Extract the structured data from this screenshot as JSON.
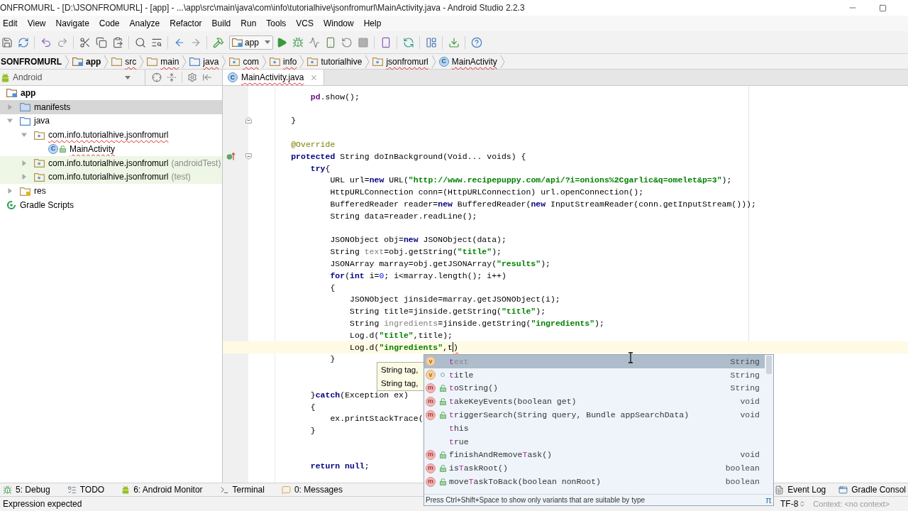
{
  "window": {
    "title": "ONFROMURL - [D:\\JSONFROMURL] - [app] - ...\\app\\src\\main\\java\\com\\info\\tutorialhive\\jsonfromurl\\MainActivity.java - Android Studio 2.2.3"
  },
  "menu": [
    "Edit",
    "View",
    "Navigate",
    "Code",
    "Analyze",
    "Refactor",
    "Build",
    "Run",
    "Tools",
    "VCS",
    "Window",
    "Help"
  ],
  "toolbar": {
    "run_config": "app"
  },
  "breadcrumbs": [
    {
      "label": "SONFROMURL",
      "kind": "project",
      "misspelled": false
    },
    {
      "label": "app",
      "kind": "module",
      "misspelled": false
    },
    {
      "label": "src",
      "kind": "folder",
      "misspelled": true
    },
    {
      "label": "main",
      "kind": "folder",
      "misspelled": true
    },
    {
      "label": "java",
      "kind": "source-folder",
      "misspelled": true
    },
    {
      "label": "com",
      "kind": "package",
      "misspelled": true
    },
    {
      "label": "info",
      "kind": "package",
      "misspelled": true
    },
    {
      "label": "tutorialhive",
      "kind": "package",
      "misspelled": false
    },
    {
      "label": "jsonfromurl",
      "kind": "package",
      "misspelled": true
    },
    {
      "label": "MainActivity",
      "kind": "class",
      "icon_letter": "C",
      "misspelled": true
    }
  ],
  "project_pane": {
    "view": "Android",
    "tree": [
      {
        "label": "app",
        "kind": "module",
        "selected": false,
        "test": false,
        "misspelled": false,
        "children": [
          {
            "label": "manifests",
            "kind": "manifest-folder",
            "expanded": false,
            "selected": true,
            "test": false,
            "misspelled": false
          },
          {
            "label": "java",
            "kind": "source-folder",
            "expanded": true,
            "selected": false,
            "test": false,
            "misspelled": false,
            "children": [
              {
                "label": "com.info.tutorialhive.jsonfromurl",
                "kind": "package",
                "expanded": true,
                "selected": false,
                "test": false,
                "misspelled": true,
                "children": [
                  {
                    "label": "MainActivity",
                    "kind": "class",
                    "icon_letter": "C",
                    "selected": false,
                    "test": false,
                    "misspelled": true
                  }
                ]
              },
              {
                "label": "com.info.tutorialhive.jsonfromurl",
                "suffix": "(androidTest)",
                "kind": "package",
                "expanded": false,
                "selected": false,
                "test": true,
                "misspelled": false
              },
              {
                "label": "com.info.tutorialhive.jsonfromurl",
                "suffix": "(test)",
                "kind": "package",
                "expanded": false,
                "selected": false,
                "test": true,
                "misspelled": false
              }
            ]
          },
          {
            "label": "res",
            "kind": "res-folder",
            "expanded": false,
            "selected": false,
            "test": false,
            "misspelled": false
          }
        ]
      },
      {
        "label": "Gradle Scripts",
        "kind": "gradle",
        "selected": false,
        "test": false,
        "misspelled": false
      }
    ]
  },
  "editor": {
    "tabs": [
      {
        "label": "MainActivity.java",
        "kind": "class",
        "icon_letter": "C",
        "selected": true,
        "misspelled": true
      }
    ],
    "lines": [
      {
        "children": [
          {
            "tokens": [
              {
                "text": "pd",
                "kind": "field"
              },
              {
                "text": ".show();",
                "kind": "plain"
              }
            ],
            "current": false
          }
        ]
      },
      {
        "current": false
      },
      {
        "gutter": [
          {
            "kind": "fold-end"
          }
        ],
        "tokens": [
          {
            "text": "}",
            "kind": "plain"
          }
        ],
        "current": false
      },
      {
        "current": false
      },
      {
        "tokens": [
          {
            "text": "@Override",
            "kind": "annotation"
          }
        ],
        "current": false
      },
      {
        "gutter": [
          {
            "kind": "override"
          },
          {
            "kind": "fold-start"
          }
        ],
        "tokens": [
          {
            "text": "protected",
            "kind": "kw"
          },
          {
            "text": " String doInBackground(Void... voids) {",
            "kind": "plain"
          }
        ],
        "current": false,
        "children": [
          {
            "tokens": [
              {
                "text": "try",
                "kind": "kw"
              },
              {
                "text": "{",
                "kind": "plain"
              }
            ],
            "current": false,
            "children": [
              {
                "tokens": [
                  {
                    "text": "URL url=",
                    "kind": "plain"
                  },
                  {
                    "text": "new",
                    "kind": "kw"
                  },
                  {
                    "text": " URL(",
                    "kind": "plain"
                  },
                  {
                    "text": "\"http://www.recipepuppy.com/api/?i=onions%2Cgarlic&q=omelet&p=3\"",
                    "kind": "str"
                  },
                  {
                    "text": ");",
                    "kind": "plain"
                  }
                ],
                "current": false
              },
              {
                "tokens": [
                  {
                    "text": "HttpURLConnection conn=(HttpURLConnection) url.openConnection();",
                    "kind": "plain"
                  }
                ],
                "current": false
              },
              {
                "tokens": [
                  {
                    "text": "BufferedReader reader=",
                    "kind": "plain"
                  },
                  {
                    "text": "new",
                    "kind": "kw"
                  },
                  {
                    "text": " BufferedReader(",
                    "kind": "plain"
                  },
                  {
                    "text": "new",
                    "kind": "kw"
                  },
                  {
                    "text": " InputStreamReader(conn.getInputStream()));",
                    "kind": "plain"
                  }
                ],
                "current": false
              },
              {
                "tokens": [
                  {
                    "text": "String data=reader.readLine();",
                    "kind": "plain"
                  }
                ],
                "current": false
              },
              {
                "current": false
              },
              {
                "tokens": [
                  {
                    "text": "JSONObject obj=",
                    "kind": "plain"
                  },
                  {
                    "text": "new",
                    "kind": "kw"
                  },
                  {
                    "text": " JSONObject(data);",
                    "kind": "plain"
                  }
                ],
                "current": false
              },
              {
                "tokens": [
                  {
                    "text": "String ",
                    "kind": "plain"
                  },
                  {
                    "text": "text",
                    "kind": "unused"
                  },
                  {
                    "text": "=obj.getString(",
                    "kind": "plain"
                  },
                  {
                    "text": "\"title\"",
                    "kind": "str"
                  },
                  {
                    "text": ");",
                    "kind": "plain"
                  }
                ],
                "current": false
              },
              {
                "tokens": [
                  {
                    "text": "JSONArray marray=obj.getJSONArray(",
                    "kind": "plain"
                  },
                  {
                    "text": "\"results\"",
                    "kind": "str"
                  },
                  {
                    "text": ");",
                    "kind": "plain"
                  }
                ],
                "current": false
              },
              {
                "tokens": [
                  {
                    "text": "for",
                    "kind": "kw"
                  },
                  {
                    "text": "(",
                    "kind": "plain"
                  },
                  {
                    "text": "int",
                    "kind": "kw"
                  },
                  {
                    "text": " i=",
                    "kind": "plain"
                  },
                  {
                    "text": "0",
                    "kind": "num"
                  },
                  {
                    "text": "; i<marray.length(); i++)",
                    "kind": "plain"
                  }
                ],
                "current": false
              },
              {
                "tokens": [
                  {
                    "text": "{",
                    "kind": "plain"
                  }
                ],
                "current": false,
                "children": [
                  {
                    "tokens": [
                      {
                        "text": "JSONObject jinside=marray.getJSONObject(i);",
                        "kind": "plain"
                      }
                    ],
                    "current": false
                  },
                  {
                    "tokens": [
                      {
                        "text": "String title=jinside.getString(",
                        "kind": "plain"
                      },
                      {
                        "text": "\"title\"",
                        "kind": "str"
                      },
                      {
                        "text": ");",
                        "kind": "plain"
                      }
                    ],
                    "current": false
                  },
                  {
                    "tokens": [
                      {
                        "text": "String ",
                        "kind": "plain"
                      },
                      {
                        "text": "ingredients",
                        "kind": "unused"
                      },
                      {
                        "text": "=jinside.getString(",
                        "kind": "plain"
                      },
                      {
                        "text": "\"ingredients\"",
                        "kind": "str"
                      },
                      {
                        "text": ");",
                        "kind": "plain"
                      }
                    ],
                    "current": false
                  },
                  {
                    "tokens": [
                      {
                        "text": "Log.d(",
                        "kind": "plain"
                      },
                      {
                        "text": "\"title\"",
                        "kind": "str"
                      },
                      {
                        "text": ",title);",
                        "kind": "plain"
                      }
                    ],
                    "current": false
                  },
                  {
                    "tokens": [
                      {
                        "text": "Log.d(",
                        "kind": "plain"
                      },
                      {
                        "text": "\"ingredients\"",
                        "kind": "str"
                      },
                      {
                        "text": ",t",
                        "kind": "plain"
                      },
                      {
                        "kind": "caret"
                      },
                      {
                        "text": ")",
                        "kind": "error"
                      }
                    ],
                    "current": true
                  }
                ]
              },
              {
                "tokens": [
                  {
                    "text": "}",
                    "kind": "plain"
                  }
                ],
                "current": false
              },
              {
                "current": false
              },
              {
                "current": false
              }
            ]
          },
          {
            "tokens": [
              {
                "text": "}",
                "kind": "plain"
              },
              {
                "text": "catch",
                "kind": "kw"
              },
              {
                "text": "(Exception ex)",
                "kind": "plain"
              }
            ],
            "current": false
          },
          {
            "tokens": [
              {
                "text": "{",
                "kind": "plain"
              }
            ],
            "current": false,
            "children": [
              {
                "tokens": [
                  {
                    "text": "ex.printStackTrace(",
                    "kind": "plain"
                  }
                ],
                "current": false
              }
            ]
          },
          {
            "tokens": [
              {
                "text": "}",
                "kind": "plain"
              }
            ],
            "current": false
          },
          {
            "current": false
          },
          {
            "current": false
          },
          {
            "tokens": [
              {
                "text": "return null",
                "kind": "kw"
              },
              {
                "text": ";",
                "kind": "plain"
              }
            ],
            "current": false
          }
        ]
      }
    ],
    "param_hints": [
      "String tag,",
      "String tag,"
    ],
    "completion": {
      "items": [
        {
          "kind": "variable",
          "icon_letter": "v",
          "label": "**t**ext",
          "type": "String",
          "selected": true,
          "unused": true
        },
        {
          "kind": "local-variable",
          "icon_letter": "v",
          "label": "**t**itle",
          "type": "String",
          "selected": false,
          "unused": false
        },
        {
          "kind": "method",
          "icon_letter": "m",
          "label": "**t**oString()",
          "type": "String",
          "selected": false,
          "unused": false
        },
        {
          "kind": "method",
          "icon_letter": "m",
          "label": "**t**akeKeyEvents(boolean get)",
          "type": "void",
          "selected": false,
          "unused": false
        },
        {
          "kind": "method",
          "icon_letter": "m",
          "label": "**t**riggerSearch(String query, Bundle appSearchData)",
          "type": "void",
          "selected": false,
          "unused": false
        },
        {
          "kind": "keyword",
          "label": "**t**his",
          "selected": false,
          "unused": false
        },
        {
          "kind": "keyword",
          "label": "**t**rue",
          "selected": false,
          "unused": false
        },
        {
          "kind": "method",
          "icon_letter": "m",
          "label": "finishAndRemove**T**ask()",
          "type": "void",
          "selected": false,
          "unused": false
        },
        {
          "kind": "method",
          "icon_letter": "m",
          "label": "is**T**askRoot()",
          "type": "boolean",
          "selected": false,
          "unused": false
        },
        {
          "kind": "method",
          "icon_letter": "m",
          "label": "move**T**askToBack(boolean nonRoot)",
          "type": "boolean",
          "selected": false,
          "unused": false
        }
      ],
      "hint": "Press Ctrl+Shift+Space to show only variants that are suitable by type",
      "pi": "π"
    }
  },
  "tool_windows": {
    "left": [
      {
        "label": "5: Debug",
        "kind": "debug"
      },
      {
        "label": "TODO",
        "kind": "todo"
      },
      {
        "label": "6: Android Monitor",
        "kind": "android"
      },
      {
        "label": "Terminal",
        "kind": "terminal"
      },
      {
        "label": "0: Messages",
        "kind": "messages"
      }
    ],
    "right": [
      {
        "label": "Event Log",
        "kind": "event-log"
      },
      {
        "label": "Gradle Consol",
        "kind": "gradle-console"
      }
    ]
  },
  "status_bar": {
    "message": "Expression expected",
    "encoding": "TF-8",
    "context": "Context: <no context>"
  }
}
